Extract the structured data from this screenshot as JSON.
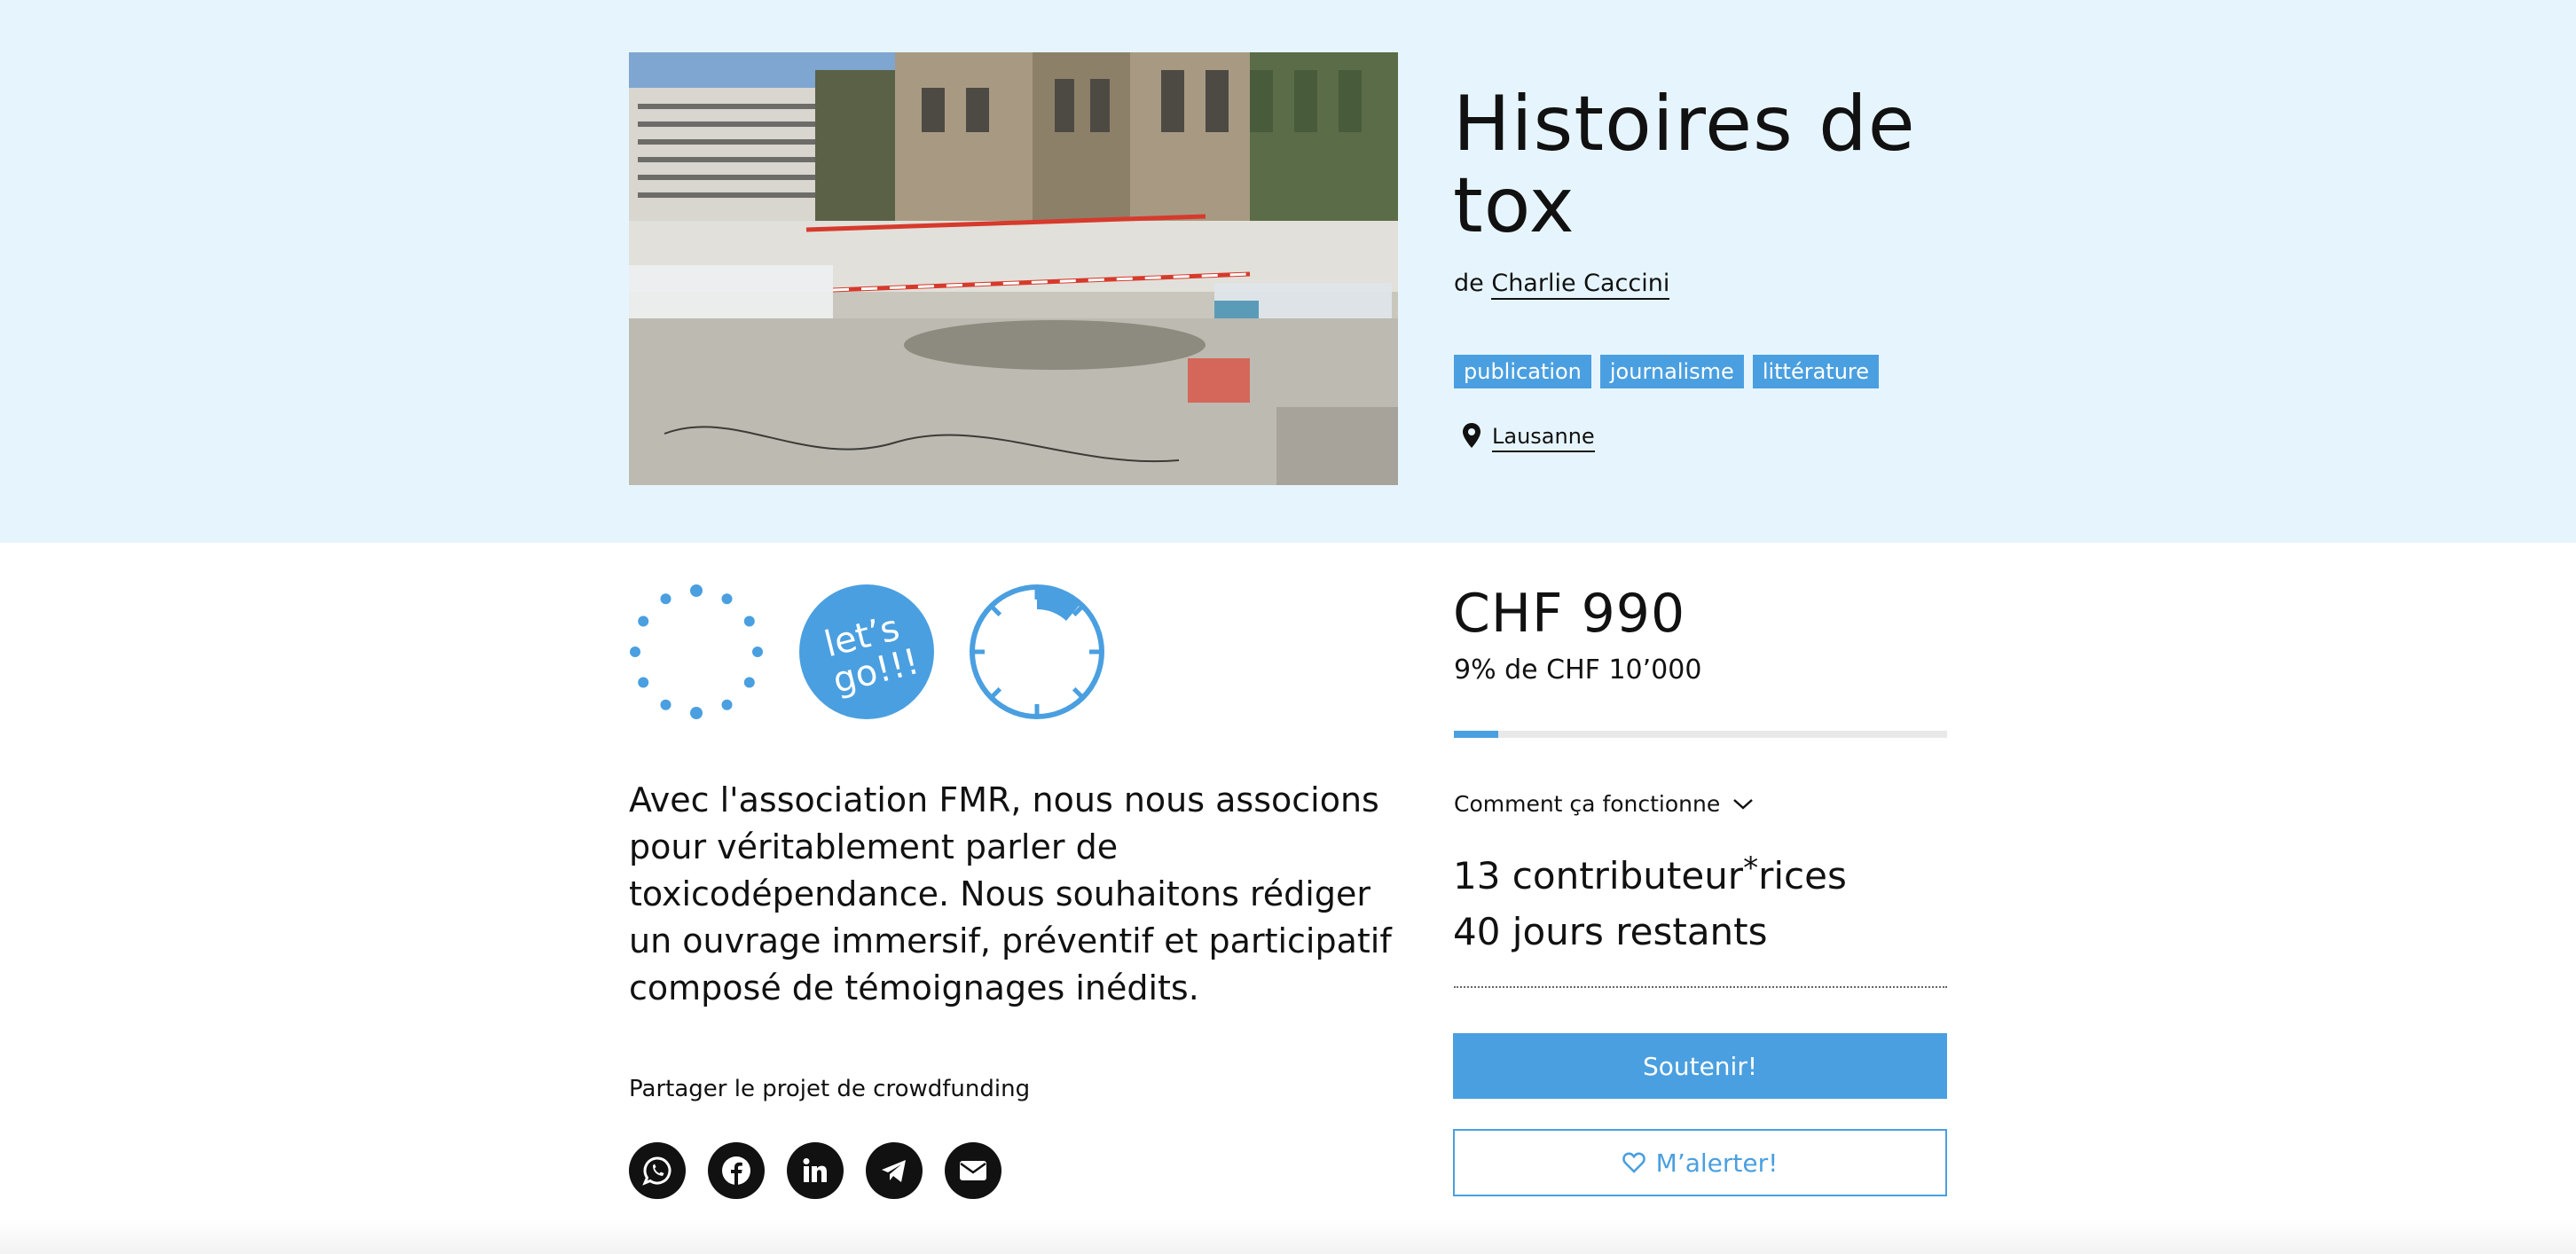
{
  "project": {
    "title": "Histoires de tox",
    "by_prefix": "de",
    "author": "Charlie Caccini",
    "tags": [
      "publication",
      "journalisme",
      "littérature"
    ],
    "location": "Lausanne",
    "description": "Avec l'association FMR, nous nous associons pour véritablement parler de toxicodépendance. Nous souhaitons rédiger un ouvrage immersif, préventif et participatif composé de témoignages inédits."
  },
  "badges": [
    {
      "icon": "dotted-circle-badge"
    },
    {
      "icon": "lets-go-badge",
      "text_line1": "let’s",
      "text_line2": "go!!!"
    },
    {
      "icon": "clock-progress-badge"
    }
  ],
  "share": {
    "label": "Partager le projet de crowdfunding",
    "networks": [
      "whatsapp-icon",
      "facebook-icon",
      "linkedin-icon",
      "telegram-icon",
      "email-icon"
    ]
  },
  "funding": {
    "amount": "CHF 990",
    "goal_text": "9% de CHF 10’000",
    "percent": 9,
    "how_it_works": "Comment ça fonctionne",
    "contributors_prefix": "13 contributeur",
    "contributors_star": "*",
    "contributors_suffix": "rices",
    "days_left": "40 jours restants",
    "support_button": "Soutenir!",
    "alert_button": "M’alerter!"
  },
  "colors": {
    "accent": "#4a9fe0",
    "hero_background": "#e6f5fd",
    "text": "#111111"
  }
}
